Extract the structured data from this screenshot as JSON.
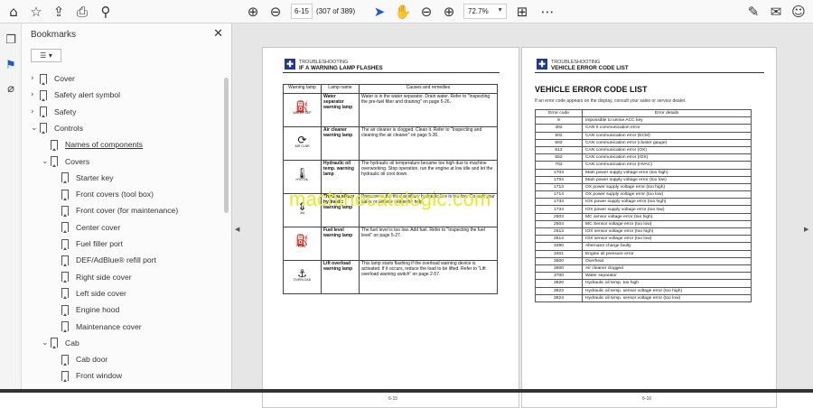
{
  "toolbar": {
    "page_input": "6-15",
    "page_total": "(307 of 389)",
    "zoom": "72.7%",
    "icons": [
      "home-icon",
      "star-icon",
      "upload-icon",
      "print-icon",
      "zoom-icon",
      "page-up-icon",
      "page-down-icon",
      "pointer-icon",
      "hand-icon",
      "zoom-out-icon",
      "zoom-in-icon",
      "fit-icon",
      "toolbar-more-icon",
      "pen-sign-icon",
      "mail-icon",
      "account-icon"
    ]
  },
  "sidebar": {
    "title": "Bookmarks",
    "items": [
      {
        "label": "Cover",
        "level": 0,
        "expander": "›",
        "link": false
      },
      {
        "label": "Safety alert symbol",
        "level": 0,
        "expander": "›",
        "link": false
      },
      {
        "label": "Safety",
        "level": 0,
        "expander": "›",
        "link": false
      },
      {
        "label": "Controls",
        "level": 0,
        "expander": "⌄",
        "link": false
      },
      {
        "label": "Names of components",
        "level": 1,
        "expander": "",
        "link": true
      },
      {
        "label": "Covers",
        "level": 1,
        "expander": "⌄",
        "link": false
      },
      {
        "label": "Starter key",
        "level": 2,
        "expander": "",
        "link": false
      },
      {
        "label": "Front covers (tool box)",
        "level": 2,
        "expander": "",
        "link": false
      },
      {
        "label": "Front cover (for maintenance)",
        "level": 2,
        "expander": "",
        "link": false
      },
      {
        "label": "Center cover",
        "level": 2,
        "expander": "",
        "link": false
      },
      {
        "label": "Fuel filler port",
        "level": 2,
        "expander": "",
        "link": false
      },
      {
        "label": "DEF/AdBlue® refill port",
        "level": 2,
        "expander": "",
        "link": false
      },
      {
        "label": "Right side cover",
        "level": 2,
        "expander": "",
        "link": false
      },
      {
        "label": "Left side cover",
        "level": 2,
        "expander": "",
        "link": false
      },
      {
        "label": "Engine hood",
        "level": 2,
        "expander": "",
        "link": false
      },
      {
        "label": "Maintenance cover",
        "level": 2,
        "expander": "",
        "link": false
      },
      {
        "label": "Cab",
        "level": 1,
        "expander": "⌄",
        "link": false
      },
      {
        "label": "Cab door",
        "level": 2,
        "expander": "",
        "link": false
      },
      {
        "label": "Front window",
        "level": 2,
        "expander": "",
        "link": false
      }
    ]
  },
  "left_page": {
    "section": "TROUBLESHOOTING",
    "heading": "IF A WARNING LAMP FLASHES",
    "columns": [
      "Warning lamp",
      "Lamp name",
      "Causes and remedies"
    ],
    "rows": [
      {
        "icon": "water-separator-lamp-icon",
        "glyph": "⛽",
        "cap": "WATER SEP",
        "name": "Water separator warning lamp",
        "remedy": "Water is in the water separator. Drain water. Refer to \"Inspecting the pre-fuel filter and draining\" on page 5-26."
      },
      {
        "icon": "air-cleaner-lamp-icon",
        "glyph": "⟳",
        "cap": "AIR CLNR",
        "name": "Air cleaner warning lamp",
        "remedy": "The air cleaner is clogged. Clean it. Refer to \"Inspecting and cleaning the air cleaner\" on page 5-30."
      },
      {
        "icon": "hydraulic-oil-lamp-icon",
        "glyph": "🌡",
        "cap": "HYD OIL",
        "name": "Hydraulic oil temp. warning lamp",
        "remedy": "The hydraulic oil temperature became too high due to machine overworking. Stop operation, run the engine at low idle and let the hydraulic oil cool down."
      },
      {
        "icon": "third-auxiliary-lamp-icon",
        "glyph": "⇕",
        "cap": "3rd",
        "name": "Third auxiliary hydraulic warning lamp",
        "remedy": "Pressure in the third auxiliary hydraulic line is too low. Consult your sales or service dealer for help."
      },
      {
        "icon": "fuel-level-lamp-icon",
        "glyph": "⛽",
        "cap": "FUEL",
        "name": "Fuel level warning lamp",
        "remedy": "The fuel level is too low. Add fuel. Refer to \"Inspecting the fuel level\" on page 5-27."
      },
      {
        "icon": "lift-overload-lamp-icon",
        "glyph": "⚓",
        "cap": "OVERLOAD",
        "name": "Lift overload warning lamp",
        "remedy": "This lamp starts flashing if the overload warning device is activated. If it occurs, reduce the load to be lifted. Refer to \"Lift overload warning switch\" on page 2-57."
      }
    ],
    "page_number": "6-15"
  },
  "right_page": {
    "section": "TROUBLESHOOTING",
    "heading": "VEHICLE ERROR CODE LIST",
    "title": "VEHICLE ERROR CODE LIST",
    "intro": "If an error code appears on the display, consult your sales or service dealer.",
    "columns": [
      "Error code",
      "Error details"
    ],
    "rows": [
      [
        "9",
        "Impossible to sense ACC key"
      ],
      [
        "402",
        "CAN 0 communication error"
      ],
      [
        "502",
        "CAN communication error (ECM)"
      ],
      [
        "602",
        "CAN communication error (cluster gauge)"
      ],
      [
        "612",
        "CAN communication error (OX)"
      ],
      [
        "652",
        "CAN communication error (IOX)"
      ],
      [
        "702",
        "CAN communication error (HVAC)"
      ],
      [
        "1703",
        "Main power supply voltage error (too high)"
      ],
      [
        "1704",
        "Main power supply voltage error (too low)"
      ],
      [
        "1713",
        "OX power supply voltage error (too high)"
      ],
      [
        "1714",
        "OX power supply voltage error (too low)"
      ],
      [
        "1733",
        "IOX power supply voltage error (too high)"
      ],
      [
        "1734",
        "IOX power supply voltage error (too low)"
      ],
      [
        "2503",
        "MC sensor voltage error (too high)"
      ],
      [
        "2504",
        "MC Sensor voltage error (too low)"
      ],
      [
        "2513",
        "IOX sensor voltage error (too high)"
      ],
      [
        "2514",
        "IOX sensor voltage error (too low)"
      ],
      [
        "3390",
        "Alternator charge faulty"
      ],
      [
        "3401",
        "Engine oil pressure error"
      ],
      [
        "3500",
        "Overheat"
      ],
      [
        "3600",
        "Air cleaner clogged"
      ],
      [
        "3700",
        "Water separator"
      ],
      [
        "3820",
        "Hydraulic oil temp. too high"
      ],
      [
        "3823",
        "Hydraulic oil temp. sensor voltage error (too high)"
      ],
      [
        "3824",
        "Hydraulic oil temp. sensor voltage error (too low)"
      ]
    ],
    "page_number": "6-16"
  },
  "watermark": "machinecatalogic.com"
}
